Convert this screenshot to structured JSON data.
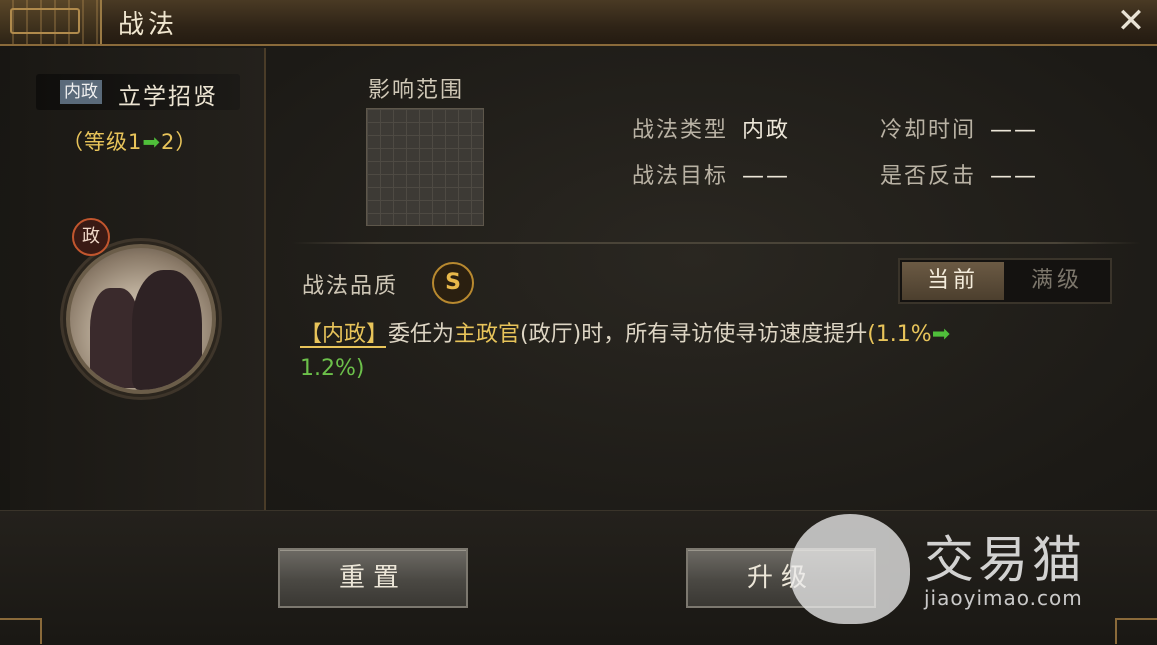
{
  "window": {
    "title": "战法",
    "close_label": "✕"
  },
  "skill": {
    "type_tag": "内政",
    "name": "立学招贤",
    "level_prefix": "（等级1",
    "level_arrow": "➡",
    "level_suffix": "2）",
    "portrait_badge": "政"
  },
  "range": {
    "label": "影响范围"
  },
  "attributes": {
    "type_label": "战法类型",
    "type_value": "内政",
    "cooldown_label": "冷却时间",
    "cooldown_value": "——",
    "target_label": "战法目标",
    "target_value": "——",
    "counter_label": "是否反击",
    "counter_value": "——"
  },
  "quality": {
    "label": "战法品质",
    "grade": "S"
  },
  "toggle": {
    "current": "当前",
    "max": "满级"
  },
  "description": {
    "tag": "【内政】",
    "text1": "委任为",
    "highlight": "主政官",
    "text2": "(政厅)时，所有寻访使寻访速度提升",
    "open": "(",
    "old_value": "1.1%",
    "arrow": "➡",
    "new_value": "1.2%",
    "close": ")"
  },
  "buttons": {
    "reset": "重置",
    "upgrade": "升级"
  },
  "watermark": {
    "brand": "交易猫",
    "url": "jiaoyimao.com"
  }
}
